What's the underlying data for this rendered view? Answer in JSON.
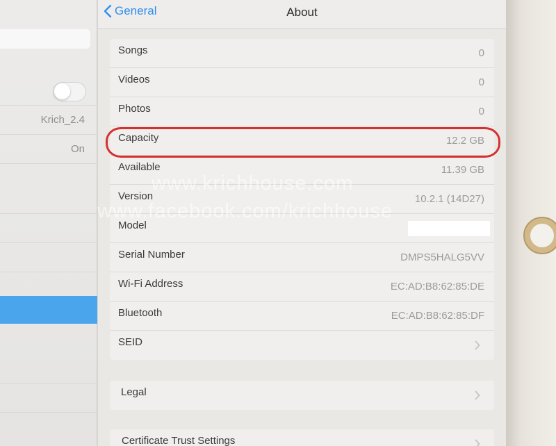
{
  "left_pane": {
    "wifi_network": "Krich_2.4",
    "bluetooth_status": "On"
  },
  "nav": {
    "back_label": "General",
    "title": "About"
  },
  "about_rows": [
    {
      "label": "Songs",
      "value": "0"
    },
    {
      "label": "Videos",
      "value": "0"
    },
    {
      "label": "Photos",
      "value": "0"
    },
    {
      "label": "Capacity",
      "value": "12.2 GB"
    },
    {
      "label": "Available",
      "value": "11.39 GB"
    },
    {
      "label": "Version",
      "value": "10.2.1 (14D27)"
    },
    {
      "label": "Model",
      "value": ""
    },
    {
      "label": "Serial Number",
      "value": "DMPS5HALG5VV"
    },
    {
      "label": "Wi-Fi Address",
      "value": "EC:AD:B8:62:85:DE"
    },
    {
      "label": "Bluetooth",
      "value": "EC:AD:B8:62:85:DF"
    },
    {
      "label": "SEID",
      "value": ""
    }
  ],
  "legal": {
    "label": "Legal"
  },
  "certificate": {
    "label": "Certificate Trust Settings"
  },
  "watermarks": [
    "www.krichhouse.com",
    "www.facebook.com/krichhouse"
  ],
  "colors": {
    "accent": "#2f8ef0",
    "highlight_circle": "#d6302f",
    "selected_row": "#4ba5ec"
  },
  "icons": {
    "back": "chevron-left-icon",
    "disclosure": "chevron-right-icon"
  }
}
